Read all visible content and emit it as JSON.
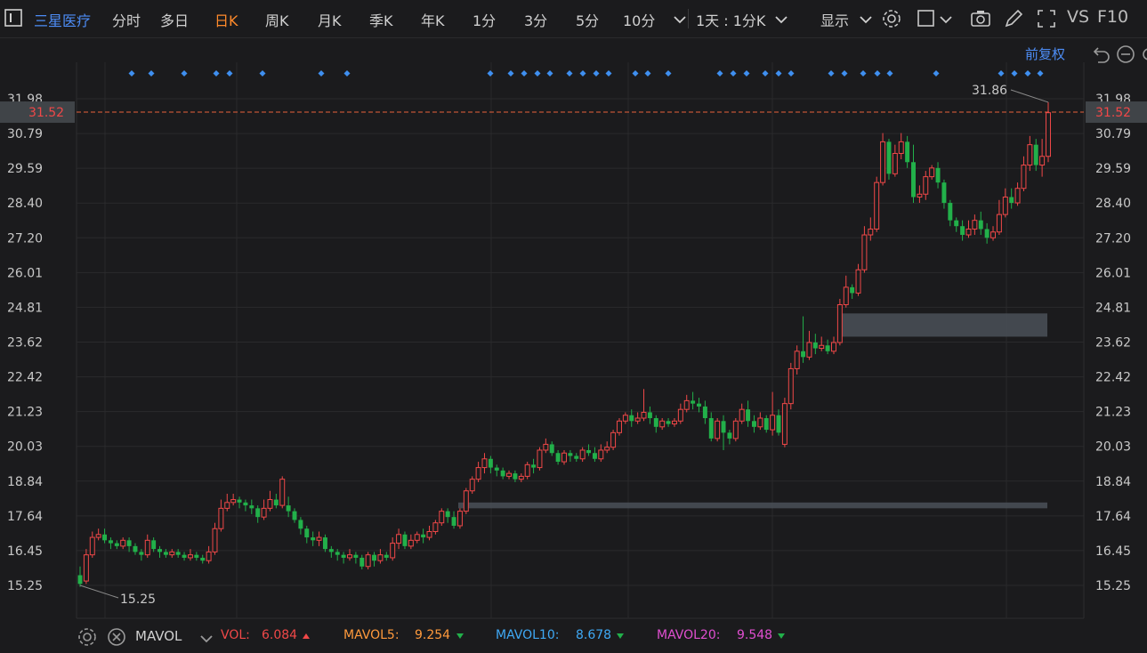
{
  "toolbar": {
    "stock_name": "三星医疗",
    "periods": [
      "分时",
      "多日",
      "日K",
      "周K",
      "月K",
      "季K",
      "年K",
      "1分",
      "3分",
      "5分",
      "10分"
    ],
    "active_period": "日K",
    "more_periods_icon": "chevron-down-icon",
    "range_label": "1天 : 1分K",
    "display_label": "显示",
    "f10_label": "F10",
    "vs_label": "VS",
    "adjust_label": "前复权",
    "icons": [
      "gear-icon",
      "square-icon",
      "camera-icon",
      "pencil-icon",
      "fullscreen-icon",
      "undo-icon",
      "minus-circle-icon"
    ]
  },
  "chart_data": {
    "type": "candlestick",
    "y_ticks": [
      "31.98",
      "30.79",
      "29.59",
      "28.40",
      "27.20",
      "26.01",
      "24.81",
      "23.62",
      "22.42",
      "21.23",
      "20.03",
      "18.84",
      "17.64",
      "16.45",
      "15.25"
    ],
    "ylim": [
      15.25,
      31.98
    ],
    "current_price_label": "31.52",
    "current_price": 31.52,
    "high_label": "31.86",
    "low_label": "15.25",
    "grid": true,
    "colors": {
      "up": "#f04848",
      "down": "#22b04a",
      "price_line": "#e8603c",
      "marker": "#3f8ff0"
    },
    "candles": [
      [
        15.6,
        15.3,
        15.2,
        15.9
      ],
      [
        15.4,
        16.3,
        15.3,
        16.5
      ],
      [
        16.3,
        16.9,
        16.2,
        17.1
      ],
      [
        16.9,
        17.0,
        16.8,
        17.2
      ],
      [
        17.0,
        16.8,
        16.7,
        17.2
      ],
      [
        16.8,
        16.7,
        16.5,
        16.9
      ],
      [
        16.7,
        16.6,
        16.5,
        16.8
      ],
      [
        16.6,
        16.8,
        16.5,
        16.9
      ],
      [
        16.8,
        16.6,
        16.4,
        16.9
      ],
      [
        16.6,
        16.4,
        16.3,
        16.7
      ],
      [
        16.4,
        16.3,
        16.1,
        16.5
      ],
      [
        16.3,
        16.8,
        16.2,
        17.0
      ],
      [
        16.8,
        16.5,
        16.4,
        16.9
      ],
      [
        16.5,
        16.4,
        16.2,
        16.6
      ],
      [
        16.4,
        16.3,
        16.2,
        16.5
      ],
      [
        16.3,
        16.4,
        16.2,
        16.5
      ],
      [
        16.4,
        16.3,
        16.2,
        16.5
      ],
      [
        16.3,
        16.2,
        16.1,
        16.4
      ],
      [
        16.2,
        16.3,
        16.1,
        16.5
      ],
      [
        16.3,
        16.2,
        16.1,
        16.4
      ],
      [
        16.2,
        16.1,
        16.0,
        16.3
      ],
      [
        16.1,
        16.4,
        16.0,
        16.6
      ],
      [
        16.4,
        17.2,
        16.3,
        17.4
      ],
      [
        17.2,
        17.9,
        17.1,
        18.2
      ],
      [
        17.9,
        18.1,
        17.8,
        18.4
      ],
      [
        18.1,
        18.2,
        18.0,
        18.4
      ],
      [
        18.2,
        18.1,
        17.9,
        18.3
      ],
      [
        18.1,
        18.0,
        17.8,
        18.2
      ],
      [
        18.0,
        17.9,
        17.7,
        18.2
      ],
      [
        17.9,
        17.6,
        17.4,
        18.0
      ],
      [
        17.6,
        17.9,
        17.5,
        18.2
      ],
      [
        17.9,
        18.2,
        17.8,
        18.5
      ],
      [
        18.2,
        18.0,
        17.9,
        18.4
      ],
      [
        18.0,
        18.9,
        17.9,
        19.0
      ],
      [
        18.0,
        17.8,
        17.6,
        18.3
      ],
      [
        17.8,
        17.5,
        17.4,
        17.9
      ],
      [
        17.5,
        17.2,
        17.0,
        17.6
      ],
      [
        17.2,
        16.9,
        16.7,
        17.3
      ],
      [
        16.9,
        16.8,
        16.6,
        17.1
      ],
      [
        16.8,
        16.9,
        16.6,
        17.1
      ],
      [
        16.9,
        16.5,
        16.4,
        17.0
      ],
      [
        16.5,
        16.4,
        16.2,
        16.6
      ],
      [
        16.4,
        16.3,
        16.1,
        16.5
      ],
      [
        16.3,
        16.2,
        16.0,
        16.4
      ],
      [
        16.2,
        16.3,
        16.1,
        16.5
      ],
      [
        16.3,
        16.2,
        16.0,
        16.4
      ],
      [
        16.2,
        15.9,
        15.8,
        16.3
      ],
      [
        15.9,
        16.3,
        15.8,
        16.4
      ],
      [
        16.3,
        16.1,
        15.9,
        16.4
      ],
      [
        16.1,
        16.3,
        16.0,
        16.5
      ],
      [
        16.3,
        16.2,
        16.1,
        16.4
      ],
      [
        16.2,
        16.7,
        16.1,
        16.9
      ],
      [
        16.7,
        17.0,
        16.5,
        17.2
      ],
      [
        17.0,
        16.6,
        16.5,
        17.1
      ],
      [
        16.6,
        16.8,
        16.5,
        17.0
      ],
      [
        16.8,
        17.0,
        16.7,
        17.1
      ],
      [
        17.0,
        16.9,
        16.7,
        17.2
      ],
      [
        16.9,
        17.1,
        16.8,
        17.3
      ],
      [
        17.1,
        17.4,
        17.0,
        17.5
      ],
      [
        17.4,
        17.8,
        17.3,
        17.9
      ],
      [
        17.8,
        17.6,
        17.4,
        17.9
      ],
      [
        17.6,
        17.3,
        17.2,
        17.8
      ],
      [
        17.3,
        17.8,
        17.2,
        17.9
      ],
      [
        17.8,
        18.5,
        17.7,
        18.6
      ],
      [
        18.5,
        18.9,
        18.4,
        19.0
      ],
      [
        18.9,
        19.3,
        18.8,
        19.5
      ],
      [
        19.3,
        19.6,
        19.1,
        19.8
      ],
      [
        19.6,
        19.3,
        19.1,
        19.7
      ],
      [
        19.3,
        19.2,
        19.0,
        19.4
      ],
      [
        19.2,
        19.0,
        18.9,
        19.3
      ],
      [
        19.0,
        19.1,
        18.9,
        19.2
      ],
      [
        19.1,
        18.9,
        18.8,
        19.2
      ],
      [
        18.9,
        19.0,
        18.8,
        19.1
      ],
      [
        19.0,
        19.4,
        18.9,
        19.5
      ],
      [
        19.4,
        19.3,
        19.1,
        19.6
      ],
      [
        19.3,
        19.9,
        19.2,
        20.0
      ],
      [
        19.9,
        20.1,
        19.8,
        20.3
      ],
      [
        20.1,
        19.8,
        19.7,
        20.2
      ],
      [
        19.8,
        19.5,
        19.4,
        19.9
      ],
      [
        19.5,
        19.8,
        19.4,
        19.9
      ],
      [
        19.8,
        19.7,
        19.5,
        19.9
      ],
      [
        19.7,
        19.6,
        19.5,
        19.8
      ],
      [
        19.6,
        19.9,
        19.5,
        20.0
      ],
      [
        19.9,
        19.8,
        19.7,
        20.1
      ],
      [
        19.8,
        19.6,
        19.5,
        20.0
      ],
      [
        19.6,
        19.9,
        19.5,
        20.1
      ],
      [
        19.9,
        20.0,
        19.8,
        20.2
      ],
      [
        20.0,
        20.5,
        19.9,
        20.6
      ],
      [
        20.5,
        20.9,
        20.4,
        21.0
      ],
      [
        20.9,
        21.1,
        20.8,
        21.2
      ],
      [
        21.1,
        20.9,
        20.7,
        21.3
      ],
      [
        20.9,
        21.0,
        20.8,
        21.2
      ],
      [
        21.0,
        21.2,
        20.9,
        22.0
      ],
      [
        21.2,
        21.0,
        20.8,
        21.4
      ],
      [
        21.0,
        20.7,
        20.5,
        21.1
      ],
      [
        20.7,
        20.9,
        20.6,
        21.0
      ],
      [
        20.9,
        20.8,
        20.7,
        21.0
      ],
      [
        20.8,
        20.9,
        20.7,
        21.0
      ],
      [
        20.9,
        21.3,
        20.8,
        21.5
      ],
      [
        21.3,
        21.6,
        21.2,
        21.8
      ],
      [
        21.6,
        21.5,
        21.3,
        21.9
      ],
      [
        21.5,
        21.4,
        21.2,
        21.7
      ],
      [
        21.4,
        21.0,
        20.8,
        21.6
      ],
      [
        21.0,
        20.3,
        20.2,
        21.2
      ],
      [
        20.3,
        20.9,
        20.2,
        21.0
      ],
      [
        20.9,
        20.5,
        19.9,
        21.1
      ],
      [
        20.5,
        20.3,
        20.1,
        20.6
      ],
      [
        20.3,
        20.9,
        20.2,
        21.0
      ],
      [
        20.9,
        21.3,
        20.8,
        21.5
      ],
      [
        21.3,
        20.9,
        20.7,
        21.6
      ],
      [
        20.9,
        20.7,
        20.5,
        21.1
      ],
      [
        20.7,
        21.0,
        20.6,
        21.2
      ],
      [
        21.0,
        20.6,
        20.5,
        21.1
      ],
      [
        20.6,
        21.1,
        20.4,
        21.9
      ],
      [
        21.1,
        20.5,
        20.4,
        21.3
      ],
      [
        20.1,
        21.5,
        20.0,
        21.7
      ],
      [
        21.5,
        22.7,
        21.3,
        22.9
      ],
      [
        22.7,
        23.3,
        22.5,
        23.5
      ],
      [
        23.3,
        23.1,
        22.9,
        24.5
      ],
      [
        23.1,
        23.6,
        23.0,
        24.0
      ],
      [
        23.6,
        23.4,
        23.2,
        23.9
      ],
      [
        23.4,
        23.5,
        23.3,
        23.8
      ],
      [
        23.5,
        23.3,
        23.2,
        23.7
      ],
      [
        23.3,
        23.6,
        23.2,
        23.8
      ],
      [
        23.6,
        24.9,
        23.5,
        25.1
      ],
      [
        24.9,
        25.5,
        24.8,
        25.9
      ],
      [
        25.5,
        25.3,
        25.1,
        25.6
      ],
      [
        25.3,
        26.1,
        25.2,
        26.3
      ],
      [
        26.1,
        27.3,
        26.0,
        27.6
      ],
      [
        27.3,
        27.5,
        27.1,
        27.9
      ],
      [
        27.5,
        29.1,
        27.4,
        29.3
      ],
      [
        29.1,
        30.5,
        29.0,
        30.8
      ],
      [
        30.5,
        29.4,
        29.2,
        30.6
      ],
      [
        29.4,
        30.1,
        29.3,
        30.4
      ],
      [
        30.1,
        30.5,
        29.9,
        30.8
      ],
      [
        30.5,
        29.8,
        29.6,
        30.7
      ],
      [
        29.8,
        28.6,
        28.4,
        30.4
      ],
      [
        28.6,
        28.7,
        28.4,
        29.0
      ],
      [
        28.7,
        29.3,
        28.5,
        29.5
      ],
      [
        29.3,
        29.6,
        29.2,
        29.7
      ],
      [
        29.6,
        29.1,
        28.9,
        29.8
      ],
      [
        29.1,
        28.4,
        28.2,
        29.2
      ],
      [
        28.4,
        27.8,
        27.6,
        28.5
      ],
      [
        27.8,
        27.6,
        27.4,
        27.9
      ],
      [
        27.6,
        27.3,
        27.1,
        27.8
      ],
      [
        27.3,
        27.5,
        27.2,
        27.8
      ],
      [
        27.5,
        27.8,
        27.3,
        28.0
      ],
      [
        27.8,
        27.5,
        27.3,
        28.1
      ],
      [
        27.5,
        27.2,
        27.0,
        27.7
      ],
      [
        27.2,
        27.4,
        27.1,
        27.6
      ],
      [
        27.4,
        28.0,
        27.3,
        28.5
      ],
      [
        28.0,
        28.6,
        27.9,
        28.9
      ],
      [
        28.6,
        28.4,
        28.2,
        28.9
      ],
      [
        28.4,
        28.9,
        28.3,
        29.1
      ],
      [
        28.9,
        29.7,
        28.8,
        30.0
      ],
      [
        29.7,
        30.4,
        29.5,
        30.7
      ],
      [
        30.4,
        29.7,
        29.5,
        30.6
      ],
      [
        29.7,
        30.0,
        29.3,
        30.6
      ],
      [
        30.0,
        31.5,
        29.8,
        31.86
      ]
    ],
    "markers": [
      148,
      170,
      207,
      243,
      258,
      295,
      361,
      390,
      551,
      574,
      589,
      604,
      618,
      640,
      655,
      670,
      684,
      714,
      728,
      751,
      809,
      824,
      839,
      860,
      875,
      889,
      934,
      949,
      970,
      986,
      1000,
      1052,
      1125,
      1140,
      1155,
      1169
    ],
    "zones": [
      {
        "low": 23.8,
        "high": 24.6
      },
      {
        "low": 17.9,
        "high": 18.1
      }
    ]
  },
  "footer": {
    "indicator_name": "MAVOL",
    "vol_label": "VOL:",
    "vol_value": "6.084",
    "mavol5_label": "MAVOL5:",
    "mavol5_value": "9.254",
    "mavol10_label": "MAVOL10:",
    "mavol10_value": "8.678",
    "mavol20_label": "MAVOL20:",
    "mavol20_value": "9.548",
    "colors": {
      "vol": "#f04848",
      "mavol5": "#ff9a3c",
      "mavol10": "#3fa9f5",
      "mavol20": "#e04fd0"
    }
  }
}
